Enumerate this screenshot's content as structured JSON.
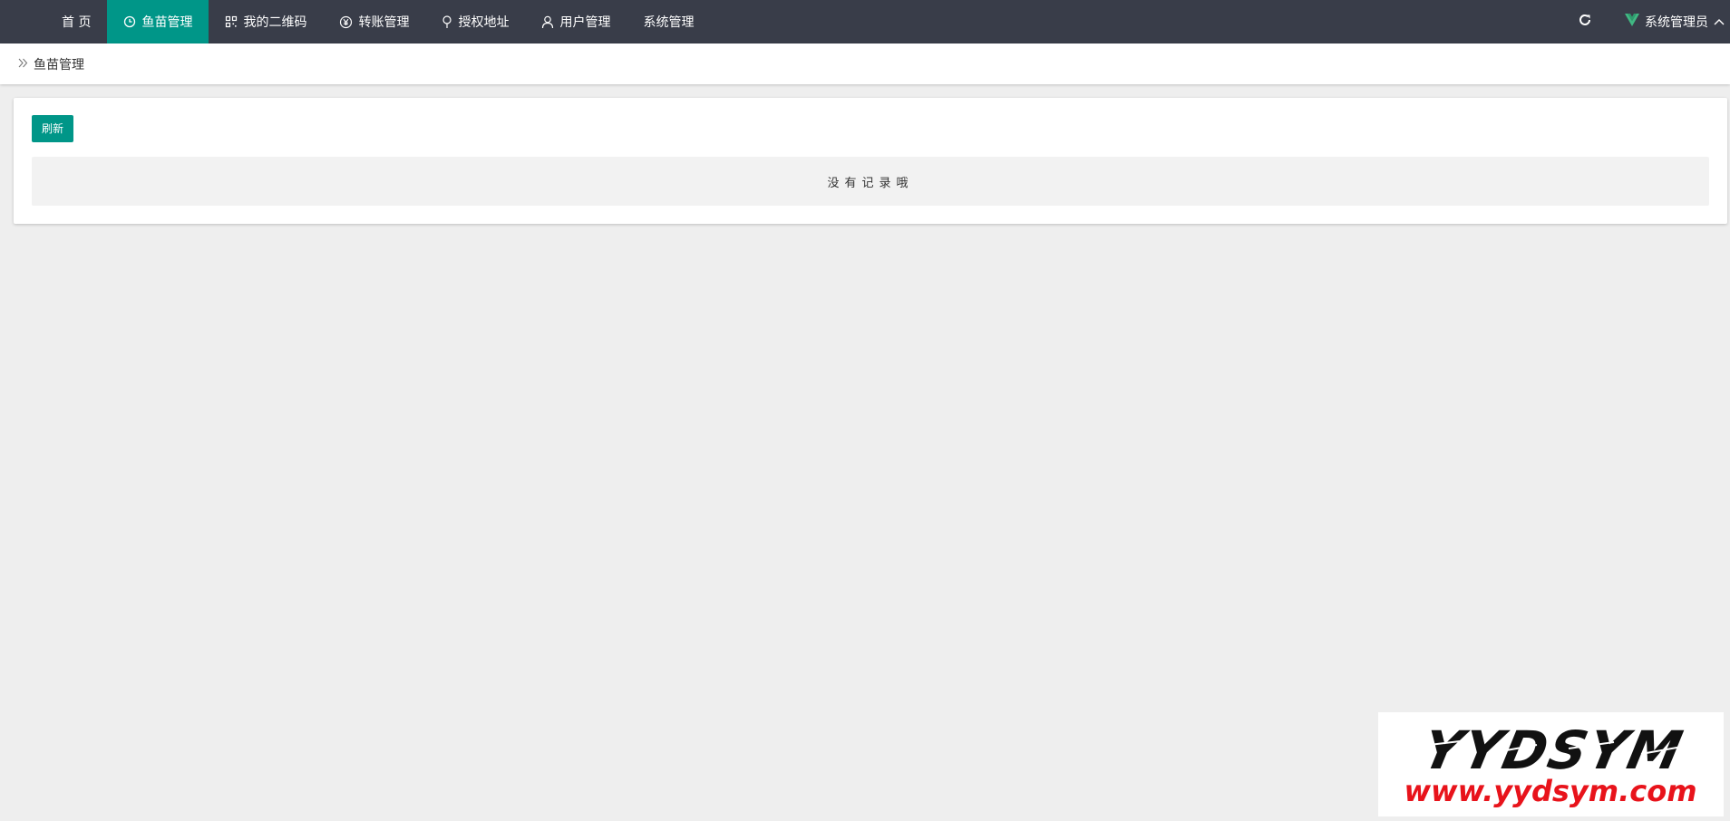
{
  "nav": {
    "items": [
      {
        "label": "首 页",
        "icon": "none"
      },
      {
        "label": "鱼苗管理",
        "icon": "clock-icon",
        "active": true
      },
      {
        "label": "我的二维码",
        "icon": "qrcode-icon"
      },
      {
        "label": "转账管理",
        "icon": "yen-icon"
      },
      {
        "label": "授权地址",
        "icon": "location-pin-icon"
      },
      {
        "label": "用户管理",
        "icon": "user-icon"
      },
      {
        "label": "系统管理",
        "icon": "none"
      }
    ]
  },
  "header": {
    "user_label": "系统管理员",
    "user_icon": "vue-logo-icon",
    "menu_icon": "chevron-up-icon",
    "refresh_icon": "refresh-icon"
  },
  "breadcrumb": {
    "current": "鱼苗管理",
    "icon": "double-chevron-right-icon"
  },
  "content": {
    "refresh_button": "刷新",
    "empty_text": "没有记录哦"
  },
  "watermark": {
    "brand": "YYDSYM",
    "url": "www.yydsym.com"
  },
  "colors": {
    "topbar": "#393d49",
    "accent": "#009688",
    "page_bg": "#eeeeee",
    "watermark_red": "#e8131b"
  }
}
